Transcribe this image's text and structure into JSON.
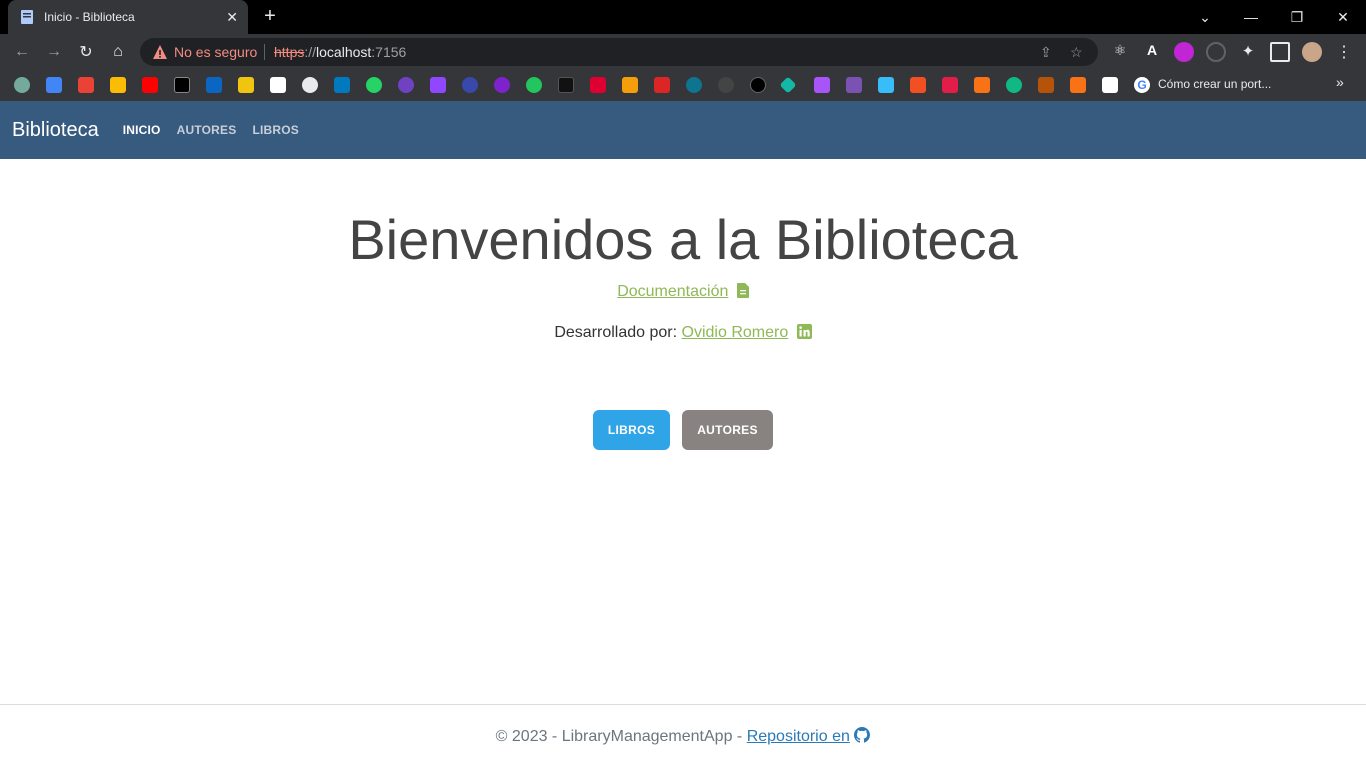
{
  "browser": {
    "tab_title": "Inicio - Biblioteca",
    "omnibox": {
      "security_text": "No es seguro",
      "url_scheme": "https",
      "url_sep": "://",
      "url_host": "localhost",
      "url_port": ":7156"
    },
    "bookmark_label": "Cómo crear un port...",
    "colors": {
      "tab_bg": "#35363a",
      "toolbar_bg": "#35363a",
      "warning": "#f28b82"
    }
  },
  "navbar": {
    "brand": "Biblioteca",
    "links": [
      {
        "label": "INICIO",
        "active": true
      },
      {
        "label": "AUTORES",
        "active": false
      },
      {
        "label": "LIBROS",
        "active": false
      }
    ],
    "color": "#375a7f"
  },
  "main": {
    "title": "Bienvenidos a la Biblioteca",
    "doc_link": "Documentación",
    "developed_by": "Desarrollado por:",
    "developer_name": "Ovidio Romero",
    "buttons": {
      "libros": "LIBROS",
      "autores": "AUTORES"
    },
    "colors": {
      "primary": "#2fa4e7",
      "secondary": "#888380",
      "link": "#8fb856"
    }
  },
  "footer": {
    "text": "© 2023 - LibraryManagementApp -",
    "repo_link": "Repositorio en"
  }
}
